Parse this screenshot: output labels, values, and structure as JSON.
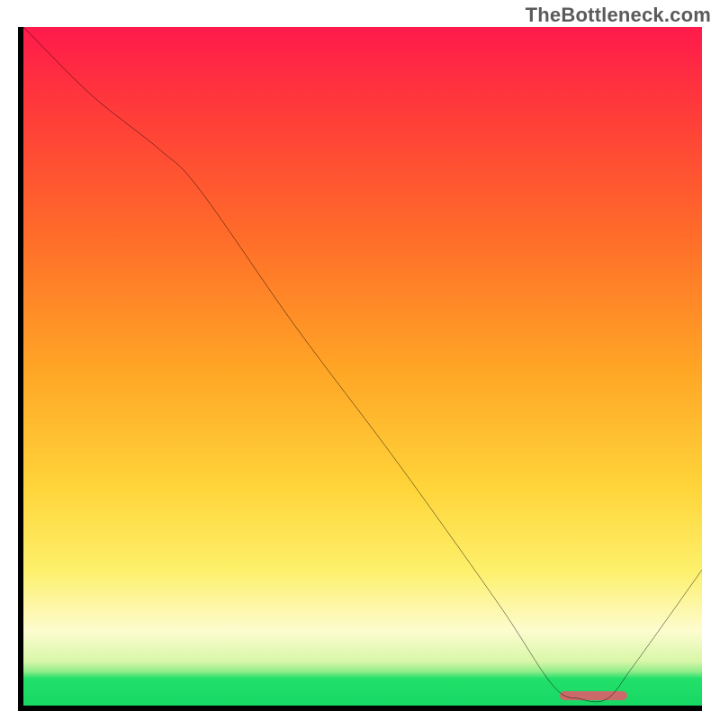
{
  "watermark": "TheBottleneck.com",
  "colors": {
    "curve": "#000000",
    "marker": "#cc6a6a",
    "axis": "#000000"
  },
  "chart_data": {
    "type": "line",
    "title": "",
    "xlabel": "",
    "ylabel": "",
    "xlim": [
      0,
      100
    ],
    "ylim": [
      0,
      100
    ],
    "x": [
      0,
      10,
      20,
      26,
      40,
      55,
      70,
      78,
      82,
      86,
      90,
      100
    ],
    "values": [
      100,
      90,
      82,
      76,
      56,
      36,
      15,
      3,
      1,
      1,
      6,
      20
    ],
    "optimum_band_x": [
      79,
      89
    ],
    "optimum_band_y": 1.5,
    "note": "y = bottleneck severity (100 = worst red, 0 = best green). Curve enters from top-left, bends around x≈26, descends ~linearly to a minimum near x≈82–86, then rises toward x=100."
  }
}
